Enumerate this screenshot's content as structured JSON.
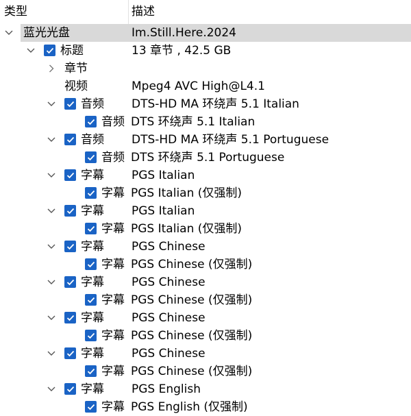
{
  "header": {
    "col_type": "类型",
    "col_desc": "描述"
  },
  "rows": [
    {
      "label": "蓝光光盘",
      "desc": "Im.Still.Here.2024",
      "level": 0,
      "arrow": "down",
      "checkbox": false,
      "selected": true
    },
    {
      "label": "标题",
      "desc": "13 章节 , 42.5 GB",
      "level": 1,
      "arrow": "down",
      "checkbox": true
    },
    {
      "label": "章节",
      "desc": "",
      "level": 2,
      "arrow": "right",
      "checkbox": false
    },
    {
      "label": "视频",
      "desc": "Mpeg4 AVC High@L4.1",
      "level": 2,
      "arrow": "none",
      "checkbox": false
    },
    {
      "label": "音频",
      "desc": "DTS-HD MA 环绕声 5.1 Italian",
      "level": 2,
      "arrow": "down",
      "checkbox": true
    },
    {
      "label": "音频",
      "desc": "DTS 环绕声 5.1 Italian",
      "level": 3,
      "arrow": "none",
      "checkbox": true,
      "inline": true
    },
    {
      "label": "音频",
      "desc": "DTS-HD MA 环绕声 5.1 Portuguese",
      "level": 2,
      "arrow": "down",
      "checkbox": true
    },
    {
      "label": "音频",
      "desc": "DTS 环绕声 5.1 Portuguese",
      "level": 3,
      "arrow": "none",
      "checkbox": true,
      "inline": true
    },
    {
      "label": "字幕",
      "desc": "PGS Italian",
      "level": 2,
      "arrow": "down",
      "checkbox": true
    },
    {
      "label": "字幕",
      "desc": "PGS Italian  (仅强制)",
      "level": 3,
      "arrow": "none",
      "checkbox": true,
      "inline": true
    },
    {
      "label": "字幕",
      "desc": "PGS Italian",
      "level": 2,
      "arrow": "down",
      "checkbox": true
    },
    {
      "label": "字幕",
      "desc": "PGS Italian  (仅强制)",
      "level": 3,
      "arrow": "none",
      "checkbox": true,
      "inline": true
    },
    {
      "label": "字幕",
      "desc": "PGS Chinese",
      "level": 2,
      "arrow": "down",
      "checkbox": true
    },
    {
      "label": "字幕",
      "desc": "PGS Chinese  (仅强制)",
      "level": 3,
      "arrow": "none",
      "checkbox": true,
      "inline": true
    },
    {
      "label": "字幕",
      "desc": "PGS Chinese",
      "level": 2,
      "arrow": "down",
      "checkbox": true
    },
    {
      "label": "字幕",
      "desc": "PGS Chinese  (仅强制)",
      "level": 3,
      "arrow": "none",
      "checkbox": true,
      "inline": true
    },
    {
      "label": "字幕",
      "desc": "PGS Chinese",
      "level": 2,
      "arrow": "down",
      "checkbox": true
    },
    {
      "label": "字幕",
      "desc": "PGS Chinese  (仅强制)",
      "level": 3,
      "arrow": "none",
      "checkbox": true,
      "inline": true
    },
    {
      "label": "字幕",
      "desc": "PGS Chinese",
      "level": 2,
      "arrow": "down",
      "checkbox": true
    },
    {
      "label": "字幕",
      "desc": "PGS Chinese  (仅强制)",
      "level": 3,
      "arrow": "none",
      "checkbox": true,
      "inline": true
    },
    {
      "label": "字幕",
      "desc": "PGS English",
      "level": 2,
      "arrow": "down",
      "checkbox": true
    },
    {
      "label": "字幕",
      "desc": "PGS English  (仅强制)",
      "level": 3,
      "arrow": "none",
      "checkbox": true,
      "inline": true
    }
  ],
  "colors": {
    "checkbox": "#1a63c5",
    "selection": "#d9d9d9",
    "arrow": "#555555"
  }
}
